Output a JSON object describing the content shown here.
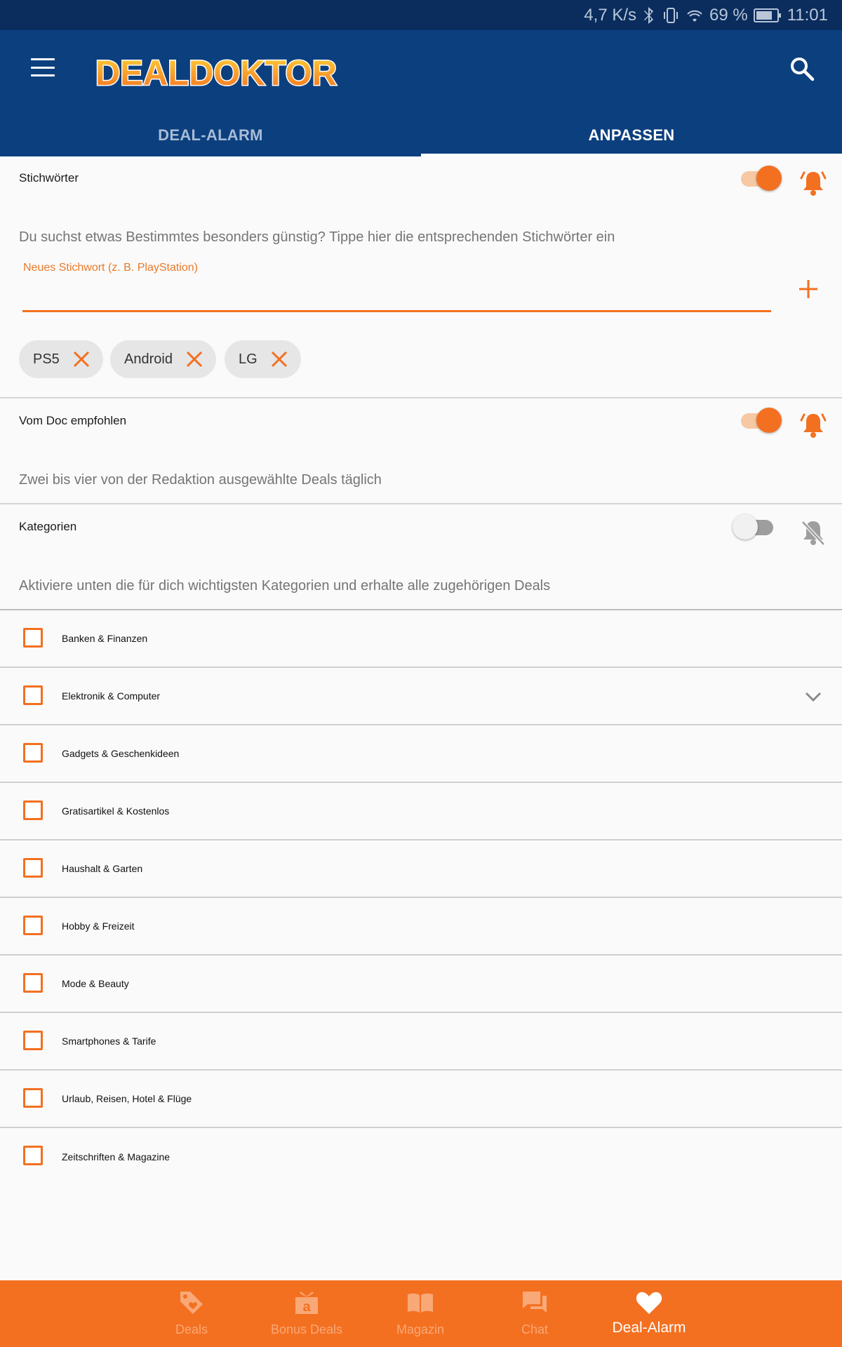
{
  "status_bar": {
    "speed": "4,7 K/s",
    "battery": "69 %",
    "time": "11:01"
  },
  "app": {
    "logo_text": "DEALDOKTOR",
    "tabs": [
      {
        "label": "DEAL-ALARM",
        "active": false
      },
      {
        "label": "ANPASSEN",
        "active": true
      }
    ]
  },
  "keywords": {
    "title": "Stichwörter",
    "enabled": true,
    "description": "Du suchst etwas Bestimmtes besonders günstig? Tippe hier die entsprechenden Stichwörter ein",
    "input_label": "Neues Stichwort (z. B. PlayStation)",
    "input_value": "",
    "chips": [
      "PS5",
      "Android",
      "LG"
    ]
  },
  "recommended": {
    "title": "Vom Doc empfohlen",
    "enabled": true,
    "description": "Zwei bis vier von der Redaktion ausgewählte Deals täglich"
  },
  "categories": {
    "title": "Kategorien",
    "enabled": false,
    "description": "Aktiviere unten die für dich wichtigsten Kategorien und erhalte alle zugehörigen Deals",
    "items": [
      {
        "label": "Banken & Finanzen",
        "checked": false
      },
      {
        "label": "Elektronik & Computer",
        "checked": false,
        "expandable": true
      },
      {
        "label": "Gadgets & Geschenkideen",
        "checked": false
      },
      {
        "label": "Gratisartikel & Kostenlos",
        "checked": false
      },
      {
        "label": "Haushalt & Garten",
        "checked": false
      },
      {
        "label": "Hobby & Freizeit",
        "checked": false
      },
      {
        "label": "Mode & Beauty",
        "checked": false
      },
      {
        "label": "Smartphones & Tarife",
        "checked": false
      },
      {
        "label": "Urlaub, Reisen, Hotel & Flüge",
        "checked": false
      },
      {
        "label": "Zeitschriften & Magazine",
        "checked": false
      }
    ]
  },
  "bottom_nav": [
    {
      "label": "Deals",
      "icon": "tag-icon",
      "active": false
    },
    {
      "label": "Bonus Deals",
      "icon": "gift-box-icon",
      "active": false
    },
    {
      "label": "Magazin",
      "icon": "open-book-icon",
      "active": false
    },
    {
      "label": "Chat",
      "icon": "chat-bubbles-icon",
      "active": false
    },
    {
      "label": "Deal-Alarm",
      "icon": "heart-icon",
      "active": true
    }
  ],
  "colors": {
    "primary_blue": "#0c3f7e",
    "status_blue": "#0a2d5e",
    "accent_orange": "#f37021"
  }
}
